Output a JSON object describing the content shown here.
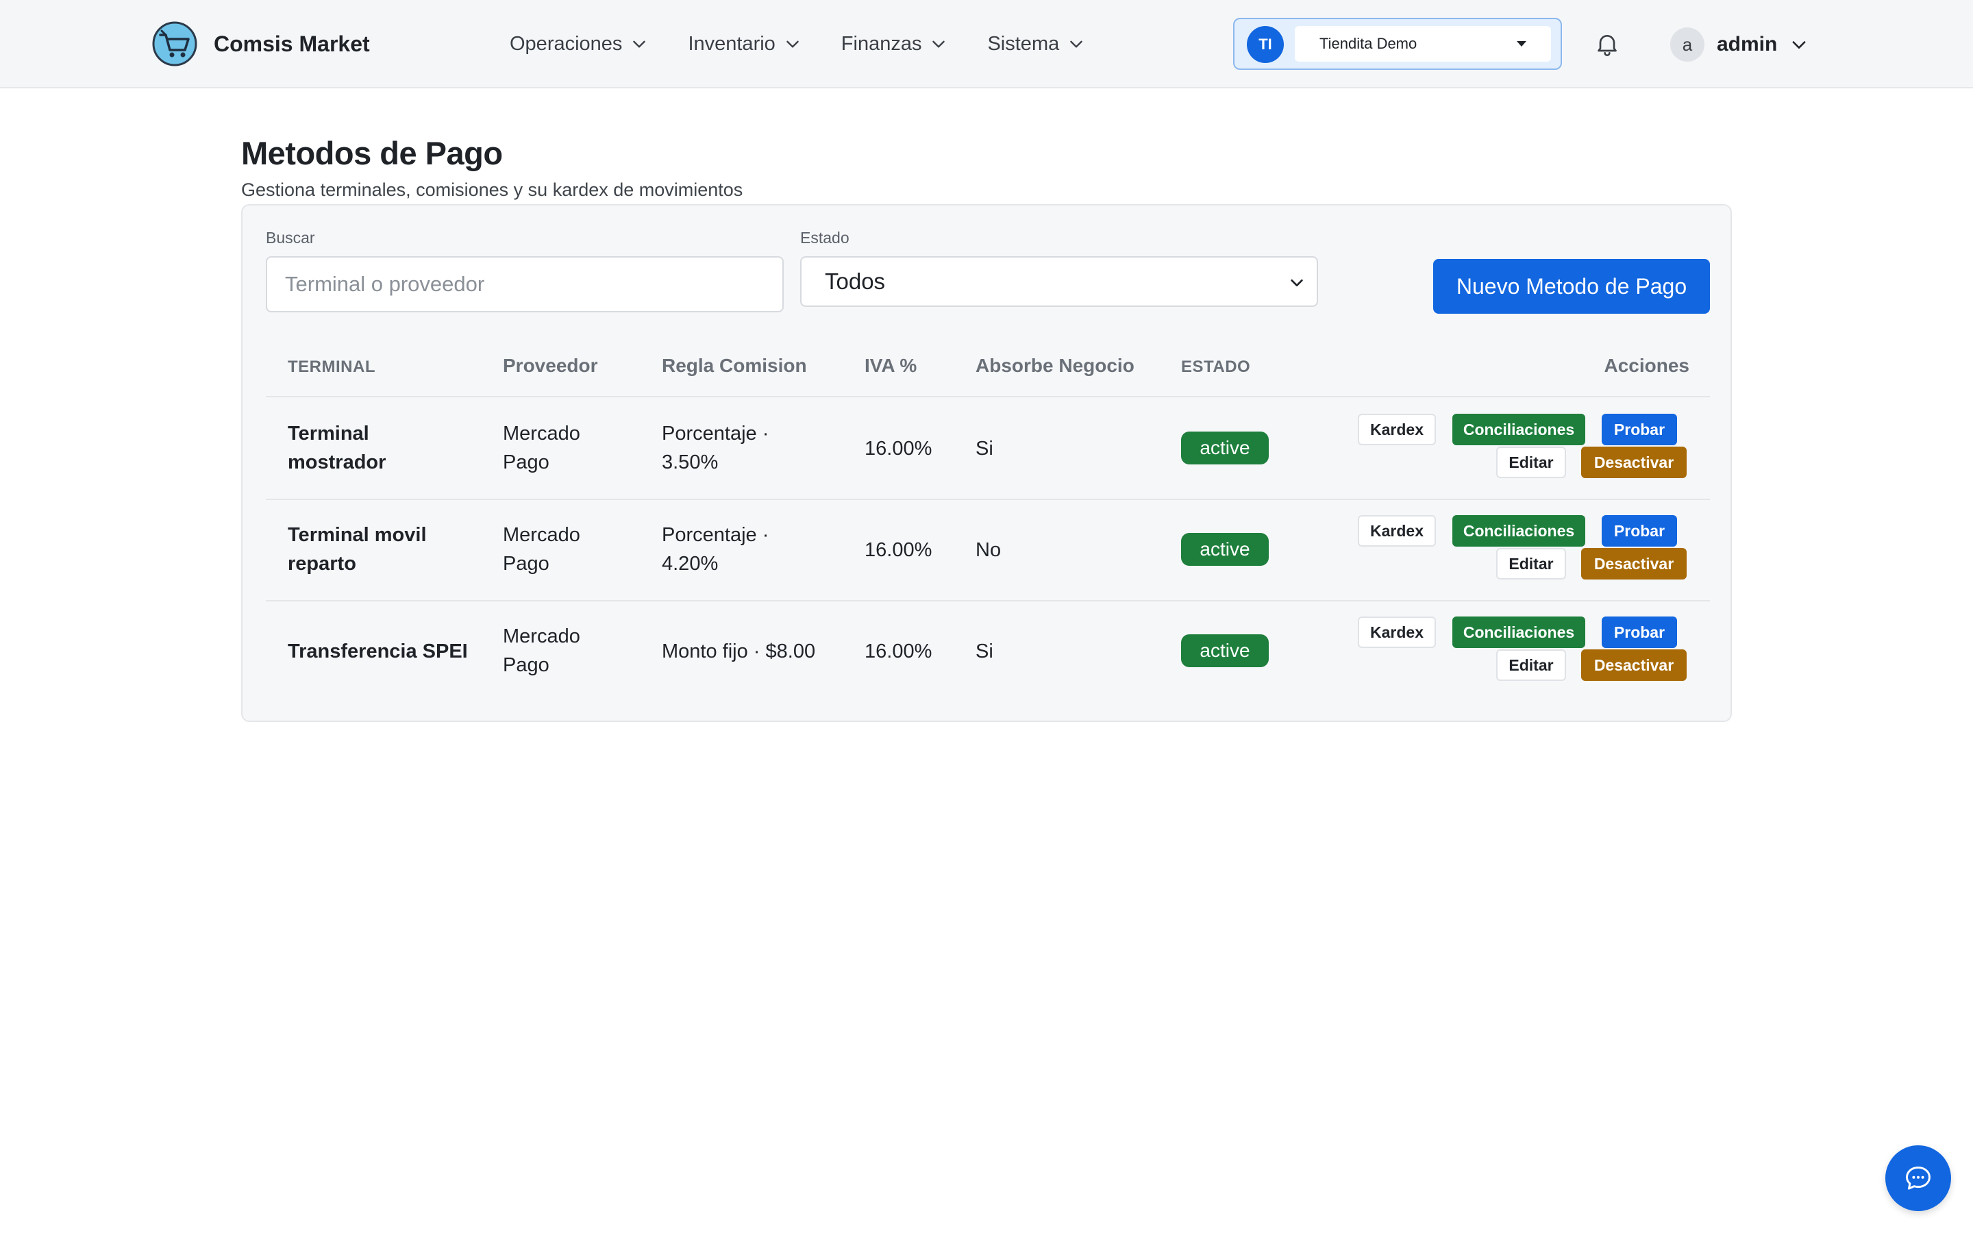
{
  "header": {
    "brand": "Comsis Market",
    "nav": [
      {
        "label": "Operaciones"
      },
      {
        "label": "Inventario"
      },
      {
        "label": "Finanzas"
      },
      {
        "label": "Sistema"
      }
    ],
    "store": {
      "initials": "TI",
      "name": "Tiendita Demo"
    },
    "user": {
      "initial": "a",
      "name": "admin"
    }
  },
  "page": {
    "title": "Metodos de Pago",
    "subtitle": "Gestiona terminales, comisiones y su kardex de movimientos"
  },
  "filters": {
    "search_label": "Buscar",
    "search_placeholder": "Terminal o proveedor",
    "search_value": "",
    "status_label": "Estado",
    "status_value": "Todos",
    "new_button": "Nuevo Metodo de Pago"
  },
  "table": {
    "headers": {
      "terminal": "TERMINAL",
      "provider": "Proveedor",
      "rule": "Regla Comision",
      "iva": "IVA %",
      "absorbs": "Absorbe Negocio",
      "status": "ESTADO",
      "actions": "Acciones"
    },
    "action_labels": {
      "kardex": "Kardex",
      "reconciliations": "Conciliaciones",
      "test": "Probar",
      "edit": "Editar",
      "deactivate": "Desactivar"
    },
    "rows": [
      {
        "terminal_l1": "Terminal",
        "terminal_l2": "mostrador",
        "provider_l1": "Mercado",
        "provider_l2": "Pago",
        "rule_l1": "Porcentaje ·",
        "rule_l2": "3.50%",
        "iva": "16.00%",
        "absorbs": "Si",
        "status": "active"
      },
      {
        "terminal_l1": "Terminal movil",
        "terminal_l2": "reparto",
        "provider_l1": "Mercado",
        "provider_l2": "Pago",
        "rule_l1": "Porcentaje ·",
        "rule_l2": "4.20%",
        "iva": "16.00%",
        "absorbs": "No",
        "status": "active"
      },
      {
        "terminal_l1": "Transferencia SPEI",
        "terminal_l2": "",
        "provider_l1": "Mercado",
        "provider_l2": "Pago",
        "rule_l1": "Monto fijo · $8.00",
        "rule_l2": "",
        "iva": "16.00%",
        "absorbs": "Si",
        "status": "active"
      }
    ]
  },
  "icons": {
    "brand": "shopping-cart-icon",
    "chevron": "chevron-down-icon",
    "bell": "bell-icon",
    "chat": "chat-bubble-icon"
  },
  "colors": {
    "primary": "#1266e0",
    "success": "#1e7f3c",
    "warning": "#a86a06"
  }
}
